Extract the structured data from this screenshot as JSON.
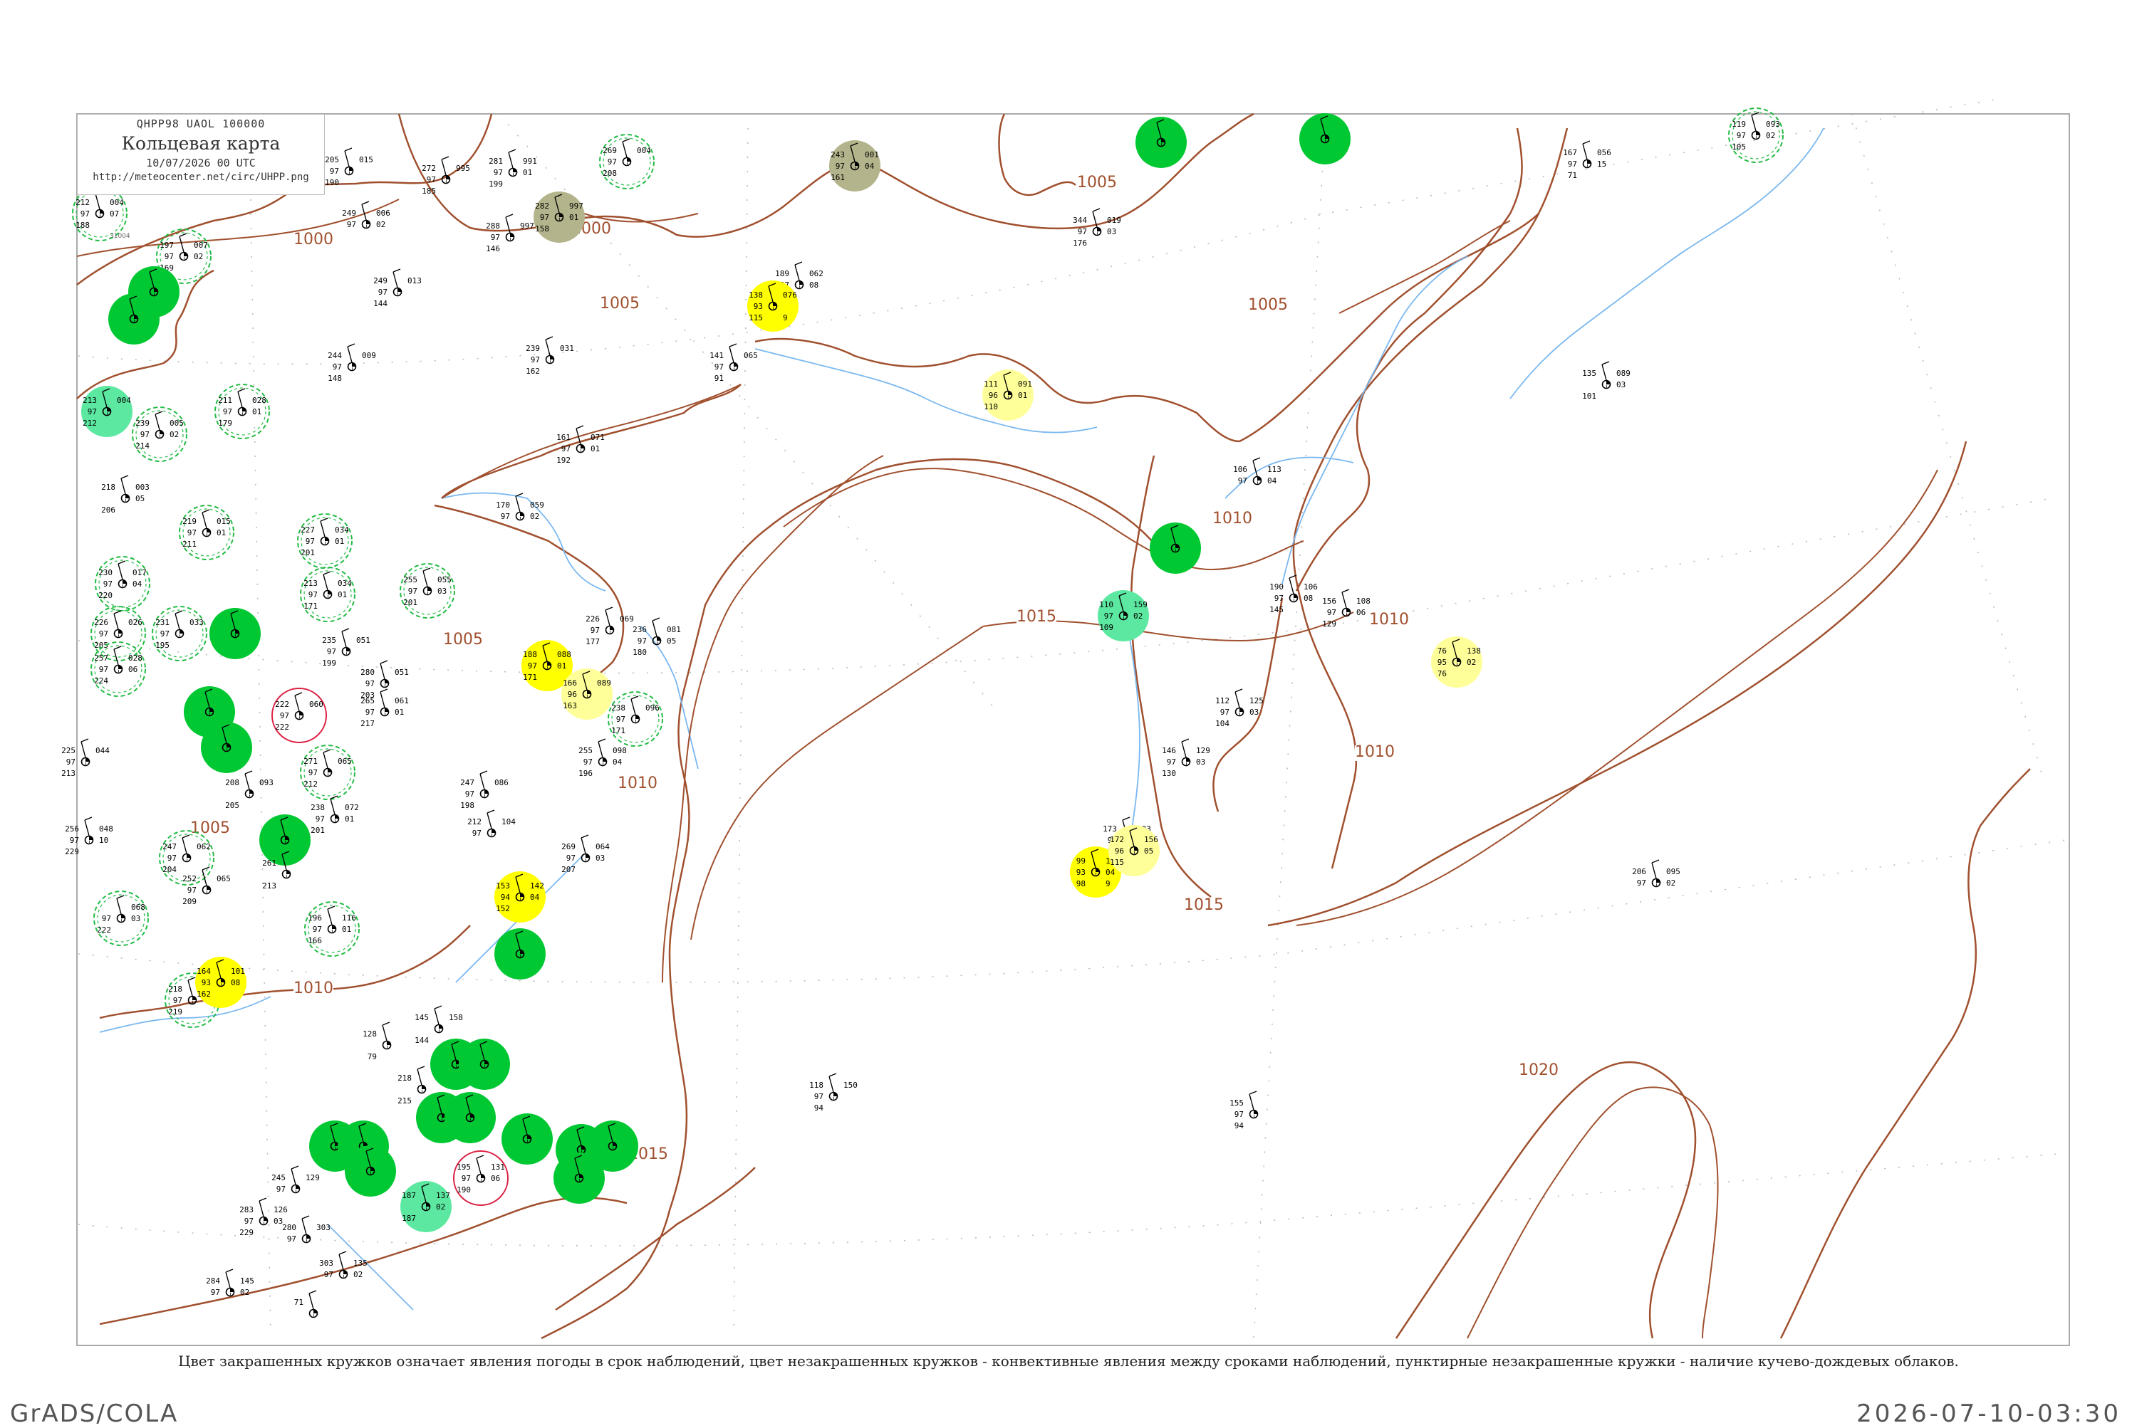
{
  "header": {
    "code": "QHPP98  UAOL  100000",
    "title": "Кольцевая карта",
    "date": "10/07/2026 00 UTC",
    "url": "http://meteocenter.net/circ/UHPP.png"
  },
  "caption": "Цвет закрашенных кружков означает явления погоды в срок наблюдений, цвет незакрашенных кружков - конвективные явления между сроками наблюдений, пунктирные незакрашенные кружки - наличие кучево-дождевых облаков.",
  "footer": {
    "left": "GrADS/COLA",
    "right": "2026-07-10-03:30"
  },
  "colors": {
    "isobar": "#a0502e",
    "river": "#7ab8f0",
    "fill_green": "#00c832",
    "fill_light_green": "#5ce8a0",
    "fill_yellow": "#ffff00",
    "fill_light_yellow": "#ffff99",
    "fill_olive": "#b4b48c",
    "ring_green": "#22bb44",
    "ring_red": "#dd2244"
  },
  "isobars": [
    {
      "label": "1000"
    },
    {
      "label": "1005"
    },
    {
      "label": "1005"
    },
    {
      "label": "1005"
    },
    {
      "label": "1005"
    },
    {
      "label": "1005"
    },
    {
      "label": "1010"
    },
    {
      "label": "1010"
    },
    {
      "label": "1010"
    },
    {
      "label": "1015"
    },
    {
      "label": "1015"
    },
    {
      "label": "1015"
    },
    {
      "label": "1020"
    },
    {
      "label": "1000"
    },
    {
      "label": "1010"
    },
    {
      "label": "1010"
    }
  ],
  "stations": [
    {
      "id": "31004",
      "name": "",
      "tl": "212",
      "tr": "004",
      "ml": "97",
      "mr": "07",
      "bl": "188",
      "br": "",
      "fill": "ring"
    },
    {
      "id": "",
      "name": "",
      "tl": "197",
      "tr": "007",
      "ml": "97",
      "mr": "02",
      "bl": "169",
      "br": "",
      "fill": "ring"
    },
    {
      "id": "",
      "name": "",
      "tl": "",
      "tr": "",
      "ml": "",
      "mr": "",
      "bl": "",
      "br": "",
      "fill": "green"
    },
    {
      "id": "",
      "name": "",
      "tl": "",
      "tr": "",
      "ml": "",
      "mr": "",
      "bl": "",
      "br": "",
      "fill": "green"
    },
    {
      "id": "",
      "name": "",
      "tl": "213",
      "tr": "004",
      "ml": "97",
      "mr": "",
      "bl": "212",
      "br": "",
      "fill": "lightgreen"
    },
    {
      "id": "",
      "name": "",
      "tl": "239",
      "tr": "005",
      "ml": "97",
      "mr": "02",
      "bl": "214",
      "br": "",
      "fill": "ring"
    },
    {
      "id": "",
      "name": "",
      "tl": "211",
      "tr": "028",
      "ml": "97",
      "mr": "01",
      "bl": "179",
      "br": "",
      "fill": "ring"
    },
    {
      "id": "",
      "name": "",
      "tl": "205",
      "tr": "015",
      "ml": "97",
      "mr": "",
      "bl": "190",
      "br": "",
      "fill": "none"
    },
    {
      "id": "",
      "name": "",
      "tl": "249",
      "tr": "006",
      "ml": "97",
      "mr": "02",
      "bl": "",
      "br": "",
      "fill": "none"
    },
    {
      "id": "",
      "name": "",
      "tl": "249",
      "tr": "013",
      "ml": "97",
      "mr": "",
      "bl": "144",
      "br": "",
      "fill": "none"
    },
    {
      "id": "",
      "name": "",
      "tl": "244",
      "tr": "009",
      "ml": "97",
      "mr": "",
      "bl": "148",
      "br": "",
      "fill": "none"
    },
    {
      "id": "",
      "name": "",
      "tl": "272",
      "tr": "995",
      "ml": "97",
      "mr": "",
      "bl": "185",
      "br": "",
      "fill": "none"
    },
    {
      "id": "",
      "name": "",
      "tl": "281",
      "tr": "991",
      "ml": "97",
      "mr": "01",
      "bl": "199",
      "br": "",
      "fill": "none"
    },
    {
      "id": "",
      "name": "",
      "tl": "288",
      "tr": "997",
      "ml": "97",
      "mr": "",
      "bl": "146",
      "br": "",
      "fill": "none"
    },
    {
      "id": "",
      "name": "",
      "tl": "282",
      "tr": "997",
      "ml": "97",
      "mr": "01",
      "bl": "158",
      "br": "",
      "fill": "olive"
    },
    {
      "id": "",
      "name": "",
      "tl": "269",
      "tr": "004",
      "ml": "97",
      "mr": "",
      "bl": "208",
      "br": "",
      "fill": "ring"
    },
    {
      "id": "",
      "name": "",
      "tl": "243",
      "tr": "001",
      "ml": "97",
      "mr": "04",
      "bl": "161",
      "br": "",
      "fill": "olive"
    },
    {
      "id": "",
      "name": "",
      "tl": "",
      "tr": "",
      "ml": "",
      "mr": "",
      "bl": "",
      "br": "",
      "fill": "green"
    },
    {
      "id": "",
      "name": "",
      "tl": "",
      "tr": "",
      "ml": "",
      "mr": "",
      "bl": "",
      "br": "",
      "fill": "green"
    },
    {
      "id": "",
      "name": "",
      "tl": "167",
      "tr": "056",
      "ml": "97",
      "mr": "15",
      "bl": "71",
      "br": "",
      "fill": "none"
    },
    {
      "id": "",
      "name": "",
      "tl": "119",
      "tr": "093",
      "ml": "97",
      "mr": "02",
      "bl": "105",
      "br": "",
      "fill": "ring"
    },
    {
      "id": "",
      "name": "",
      "tl": "344",
      "tr": "019",
      "ml": "97",
      "mr": "03",
      "bl": "176",
      "br": "",
      "fill": "none"
    },
    {
      "id": "",
      "name": "",
      "tl": "189",
      "tr": "062",
      "ml": "97",
      "mr": "08",
      "bl": "",
      "br": "",
      "fill": "none"
    },
    {
      "id": "",
      "name": "",
      "tl": "138",
      "tr": "076",
      "ml": "93",
      "mr": "",
      "bl": "115",
      "br": "9",
      "fill": "yellow"
    },
    {
      "id": "",
      "name": "",
      "tl": "141",
      "tr": "065",
      "ml": "97",
      "mr": "",
      "bl": "91",
      "br": "",
      "fill": "none"
    },
    {
      "id": "",
      "name": "",
      "tl": "239",
      "tr": "031",
      "ml": "97",
      "mr": "",
      "bl": "162",
      "br": "",
      "fill": "none"
    },
    {
      "id": "",
      "name": "",
      "tl": "111",
      "tr": "091",
      "ml": "96",
      "mr": "01",
      "bl": "110",
      "br": "",
      "fill": "lightyellow"
    },
    {
      "id": "",
      "name": "",
      "tl": "135",
      "tr": "089",
      "ml": "",
      "mr": "03",
      "bl": "101",
      "br": "",
      "fill": "none"
    },
    {
      "id": "",
      "name": "",
      "tl": "161",
      "tr": "071",
      "ml": "97",
      "mr": "01",
      "bl": "192",
      "br": "",
      "fill": "none"
    },
    {
      "id": "",
      "name": "",
      "tl": "218",
      "tr": "003",
      "ml": "",
      "mr": "05",
      "bl": "206",
      "br": "",
      "fill": "none"
    },
    {
      "id": "",
      "name": "",
      "tl": "170",
      "tr": "059",
      "ml": "97",
      "mr": "02",
      "bl": "",
      "br": "",
      "fill": "none"
    },
    {
      "id": "",
      "name": "",
      "tl": "106",
      "tr": "113",
      "ml": "97",
      "mr": "04",
      "bl": "",
      "br": "",
      "fill": "none"
    },
    {
      "id": "",
      "name": "",
      "tl": "",
      "tr": "",
      "ml": "",
      "mr": "",
      "bl": "",
      "br": "",
      "fill": "green"
    },
    {
      "id": "",
      "name": "",
      "tl": "219",
      "tr": "015",
      "ml": "97",
      "mr": "01",
      "bl": "211",
      "br": "",
      "fill": "ring"
    },
    {
      "id": "",
      "name": "",
      "tl": "227",
      "tr": "034",
      "ml": "97",
      "mr": "01",
      "bl": "201",
      "br": "",
      "fill": "ring"
    },
    {
      "id": "",
      "name": "",
      "tl": "213",
      "tr": "034",
      "ml": "97",
      "mr": "01",
      "bl": "171",
      "br": "",
      "fill": "ring"
    },
    {
      "id": "",
      "name": "",
      "tl": "255",
      "tr": "055",
      "ml": "97",
      "mr": "03",
      "bl": "201",
      "br": "",
      "fill": "ring"
    },
    {
      "id": "",
      "name": "",
      "tl": "230",
      "tr": "017",
      "ml": "97",
      "mr": "04",
      "bl": "220",
      "br": "",
      "fill": "ring"
    },
    {
      "id": "",
      "name": "",
      "tl": "226",
      "tr": "026",
      "ml": "97",
      "mr": "",
      "bl": "205",
      "br": "",
      "fill": "ring"
    },
    {
      "id": "",
      "name": "",
      "tl": "231",
      "tr": "033",
      "ml": "97",
      "mr": "",
      "bl": "195",
      "br": "",
      "fill": "ring"
    },
    {
      "id": "",
      "name": "",
      "tl": "",
      "tr": "",
      "ml": "",
      "mr": "",
      "bl": "",
      "br": "",
      "fill": "green"
    },
    {
      "id": "",
      "name": "",
      "tl": "257",
      "tr": "028",
      "ml": "97",
      "mr": "06",
      "bl": "224",
      "br": "",
      "fill": "ring"
    },
    {
      "id": "",
      "name": "",
      "tl": "235",
      "tr": "051",
      "ml": "97",
      "mr": "",
      "bl": "199",
      "br": "",
      "fill": "none"
    },
    {
      "id": "",
      "name": "",
      "tl": "226",
      "tr": "069",
      "ml": "97",
      "mr": "",
      "bl": "177",
      "br": "",
      "fill": "none"
    },
    {
      "id": "",
      "name": "",
      "tl": "236",
      "tr": "081",
      "ml": "97",
      "mr": "05",
      "bl": "180",
      "br": "",
      "fill": "none"
    },
    {
      "id": "",
      "name": "",
      "tl": "190",
      "tr": "106",
      "ml": "97",
      "mr": "08",
      "bl": "145",
      "br": "",
      "fill": "none"
    },
    {
      "id": "",
      "name": "",
      "tl": "156",
      "tr": "108",
      "ml": "97",
      "mr": "06",
      "bl": "129",
      "br": "",
      "fill": "none"
    },
    {
      "id": "",
      "name": "",
      "tl": "110",
      "tr": "159",
      "ml": "97",
      "mr": "02",
      "bl": "109",
      "br": "",
      "fill": "lightgreen"
    },
    {
      "id": "",
      "name": "",
      "tl": "76",
      "tr": "138",
      "ml": "95",
      "mr": "02",
      "bl": "76",
      "br": "",
      "fill": "lightyellow"
    },
    {
      "id": "",
      "name": "",
      "tl": "188",
      "tr": "088",
      "ml": "97",
      "mr": "01",
      "bl": "171",
      "br": "",
      "fill": "yellow"
    },
    {
      "id": "",
      "name": "",
      "tl": "166",
      "tr": "089",
      "ml": "96",
      "mr": "",
      "bl": "163",
      "br": "",
      "fill": "lightyellow"
    },
    {
      "id": "",
      "name": "",
      "tl": "238",
      "tr": "096",
      "ml": "97",
      "mr": "",
      "bl": "171",
      "br": "",
      "fill": "ring"
    },
    {
      "id": "",
      "name": "",
      "tl": "222",
      "tr": "060",
      "ml": "97",
      "mr": "",
      "bl": "222",
      "br": "",
      "fill": "redring"
    },
    {
      "id": "",
      "name": "",
      "tl": "280",
      "tr": "051",
      "ml": "97",
      "mr": "",
      "bl": "203",
      "br": "",
      "fill": "none"
    },
    {
      "id": "",
      "name": "",
      "tl": "265",
      "tr": "061",
      "ml": "97",
      "mr": "01",
      "bl": "217",
      "br": "",
      "fill": "none"
    },
    {
      "id": "",
      "name": "",
      "tl": "",
      "tr": "",
      "ml": "",
      "mr": "",
      "bl": "",
      "br": "",
      "fill": "green"
    },
    {
      "id": "",
      "name": "",
      "tl": "",
      "tr": "",
      "ml": "",
      "mr": "",
      "bl": "",
      "br": "",
      "fill": "green"
    },
    {
      "id": "",
      "name": "",
      "tl": "225",
      "tr": "044",
      "ml": "97",
      "mr": "",
      "bl": "213",
      "br": "",
      "fill": "none"
    },
    {
      "id": "",
      "name": "",
      "tl": "271",
      "tr": "065",
      "ml": "97",
      "mr": "",
      "bl": "212",
      "br": "",
      "fill": "ring"
    },
    {
      "id": "",
      "name": "",
      "tl": "238",
      "tr": "072",
      "ml": "97",
      "mr": "01",
      "bl": "201",
      "br": "",
      "fill": "none"
    },
    {
      "id": "",
      "name": "",
      "tl": "255",
      "tr": "098",
      "ml": "97",
      "mr": "04",
      "bl": "196",
      "br": "",
      "fill": "none"
    },
    {
      "id": "",
      "name": "",
      "tl": "247",
      "tr": "086",
      "ml": "97",
      "mr": "",
      "bl": "198",
      "br": "",
      "fill": "none"
    },
    {
      "id": "",
      "name": "",
      "tl": "212",
      "tr": "104",
      "ml": "97",
      "mr": "",
      "bl": "",
      "br": "",
      "fill": "none"
    },
    {
      "id": "",
      "name": "",
      "tl": "112",
      "tr": "125",
      "ml": "97",
      "mr": "03",
      "bl": "104",
      "br": "",
      "fill": "none"
    },
    {
      "id": "",
      "name": "",
      "tl": "146",
      "tr": "129",
      "ml": "97",
      "mr": "03",
      "bl": "130",
      "br": "",
      "fill": "none"
    },
    {
      "id": "",
      "name": "",
      "tl": "256",
      "tr": "048",
      "ml": "97",
      "mr": "10",
      "bl": "229",
      "br": "",
      "fill": "none"
    },
    {
      "id": "",
      "name": "",
      "tl": "",
      "tr": "",
      "ml": "",
      "mr": "",
      "bl": "",
      "br": "",
      "fill": "green"
    },
    {
      "id": "",
      "name": "",
      "tl": "247",
      "tr": "062",
      "ml": "97",
      "mr": "",
      "bl": "204",
      "br": "",
      "fill": "ring"
    },
    {
      "id": "",
      "name": "",
      "tl": "252",
      "tr": "065",
      "ml": "97",
      "mr": "",
      "bl": "209",
      "br": "",
      "fill": "none"
    },
    {
      "id": "",
      "name": "",
      "tl": "",
      "tr": "068",
      "ml": "97",
      "mr": "03",
      "bl": "222",
      "br": "",
      "fill": "ring"
    },
    {
      "id": "",
      "name": "",
      "tl": "269",
      "tr": "064",
      "ml": "97",
      "mr": "03",
      "bl": "207",
      "br": "",
      "fill": "none"
    },
    {
      "id": "",
      "name": "",
      "tl": "153",
      "tr": "142",
      "ml": "94",
      "mr": "04",
      "bl": "152",
      "br": "",
      "fill": "yellow"
    },
    {
      "id": "",
      "name": "",
      "tl": "196",
      "tr": "116",
      "ml": "97",
      "mr": "01",
      "bl": "166",
      "br": "",
      "fill": "ring"
    },
    {
      "id": "",
      "name": "",
      "tl": "173",
      "tr": "093",
      "ml": "97",
      "mr": "04",
      "bl": "173",
      "br": "",
      "fill": "none"
    },
    {
      "id": "",
      "name": "",
      "tl": "99",
      "tr": "168",
      "ml": "93",
      "mr": "04",
      "bl": "98",
      "br": "9",
      "fill": "yellow"
    },
    {
      "id": "",
      "name": "",
      "tl": "172",
      "tr": "156",
      "ml": "96",
      "mr": "05",
      "bl": "115",
      "br": "",
      "fill": "lightyellow"
    },
    {
      "id": "",
      "name": "",
      "tl": "",
      "tr": "",
      "ml": "",
      "mr": "",
      "bl": "",
      "br": "",
      "fill": "green"
    },
    {
      "id": "",
      "name": "",
      "tl": "218",
      "tr": "120",
      "ml": "97",
      "mr": "",
      "bl": "219",
      "br": "",
      "fill": "ring"
    },
    {
      "id": "",
      "name": "",
      "tl": "164",
      "tr": "101",
      "ml": "93",
      "mr": "08",
      "bl": "162",
      "br": "",
      "fill": "yellow"
    },
    {
      "id": "",
      "name": "",
      "tl": "206",
      "tr": "095",
      "ml": "97",
      "mr": "02",
      "bl": "",
      "br": "",
      "fill": "none"
    },
    {
      "id": "",
      "name": "",
      "tl": "118",
      "tr": "150",
      "ml": "97",
      "mr": "",
      "bl": "94",
      "br": "",
      "fill": "none"
    },
    {
      "id": "",
      "name": "",
      "tl": "155",
      "tr": "",
      "ml": "97",
      "mr": "",
      "bl": "94",
      "br": "",
      "fill": "none"
    },
    {
      "id": "",
      "name": "",
      "tl": "145",
      "tr": "158",
      "ml": "",
      "mr": "",
      "bl": "144",
      "br": "",
      "fill": "none"
    },
    {
      "id": "",
      "name": "",
      "tl": "",
      "tr": "",
      "ml": "",
      "mr": "",
      "bl": "",
      "br": "",
      "fill": "green"
    },
    {
      "id": "",
      "name": "",
      "tl": "",
      "tr": "",
      "ml": "",
      "mr": "",
      "bl": "",
      "br": "",
      "fill": "green"
    },
    {
      "id": "",
      "name": "",
      "tl": "",
      "tr": "",
      "ml": "",
      "mr": "",
      "bl": "",
      "br": "",
      "fill": "green"
    },
    {
      "id": "",
      "name": "",
      "tl": "",
      "tr": "",
      "ml": "",
      "mr": "",
      "bl": "",
      "br": "",
      "fill": "green"
    },
    {
      "id": "",
      "name": "",
      "tl": "",
      "tr": "",
      "ml": "",
      "mr": "",
      "bl": "",
      "br": "",
      "fill": "green"
    },
    {
      "id": "",
      "name": "",
      "tl": "",
      "tr": "",
      "ml": "",
      "mr": "",
      "bl": "",
      "br": "",
      "fill": "green"
    },
    {
      "id": "",
      "name": "",
      "tl": "",
      "tr": "",
      "ml": "",
      "mr": "",
      "bl": "",
      "br": "",
      "fill": "green"
    },
    {
      "id": "",
      "name": "",
      "tl": "",
      "tr": "",
      "ml": "",
      "mr": "",
      "bl": "",
      "br": "",
      "fill": "green"
    },
    {
      "id": "",
      "name": "",
      "tl": "",
      "tr": "",
      "ml": "",
      "mr": "",
      "bl": "",
      "br": "",
      "fill": "green"
    },
    {
      "id": "",
      "name": "",
      "tl": "",
      "tr": "",
      "ml": "",
      "mr": "",
      "bl": "",
      "br": "",
      "fill": "green"
    },
    {
      "id": "",
      "name": "",
      "tl": "",
      "tr": "",
      "ml": "",
      "mr": "",
      "bl": "",
      "br": "",
      "fill": "green"
    },
    {
      "id": "",
      "name": "",
      "tl": "187",
      "tr": "137",
      "ml": "",
      "mr": "02",
      "bl": "187",
      "br": "",
      "fill": "lightgreen"
    },
    {
      "id": "",
      "name": "",
      "tl": "195",
      "tr": "131",
      "ml": "97",
      "mr": "06",
      "bl": "190",
      "br": "",
      "fill": "redring"
    },
    {
      "id": "",
      "name": "",
      "tl": "128",
      "tr": "",
      "ml": "",
      "mr": "",
      "bl": "79",
      "br": "",
      "fill": "none"
    },
    {
      "id": "",
      "name": "",
      "tl": "218",
      "tr": "",
      "ml": "",
      "mr": "",
      "bl": "215",
      "br": "",
      "fill": "none"
    },
    {
      "id": "",
      "name": "",
      "tl": "245",
      "tr": "129",
      "ml": "97",
      "mr": "",
      "bl": "",
      "br": "",
      "fill": "none"
    },
    {
      "id": "",
      "name": "",
      "tl": "283",
      "tr": "126",
      "ml": "97",
      "mr": "03",
      "bl": "229",
      "br": "",
      "fill": "none"
    },
    {
      "id": "",
      "name": "",
      "tl": "280",
      "tr": "303",
      "ml": "97",
      "mr": "",
      "bl": "",
      "br": "",
      "fill": "none"
    },
    {
      "id": "",
      "name": "",
      "tl": "303",
      "tr": "135",
      "ml": "97",
      "mr": "02",
      "bl": "",
      "br": "",
      "fill": "none"
    },
    {
      "id": "",
      "name": "",
      "tl": "284",
      "tr": "145",
      "ml": "97",
      "mr": "02",
      "bl": "",
      "br": "",
      "fill": "none"
    },
    {
      "id": "",
      "name": "",
      "tl": "71",
      "tr": "",
      "ml": "",
      "mr": "",
      "bl": "",
      "br": "",
      "fill": "none"
    },
    {
      "id": "",
      "name": "",
      "tl": "208",
      "tr": "093",
      "ml": "",
      "mr": "",
      "bl": "205",
      "br": "",
      "fill": "none"
    },
    {
      "id": "",
      "name": "",
      "tl": "261",
      "tr": "",
      "ml": "",
      "mr": "",
      "bl": "213",
      "br": "",
      "fill": "none"
    }
  ]
}
